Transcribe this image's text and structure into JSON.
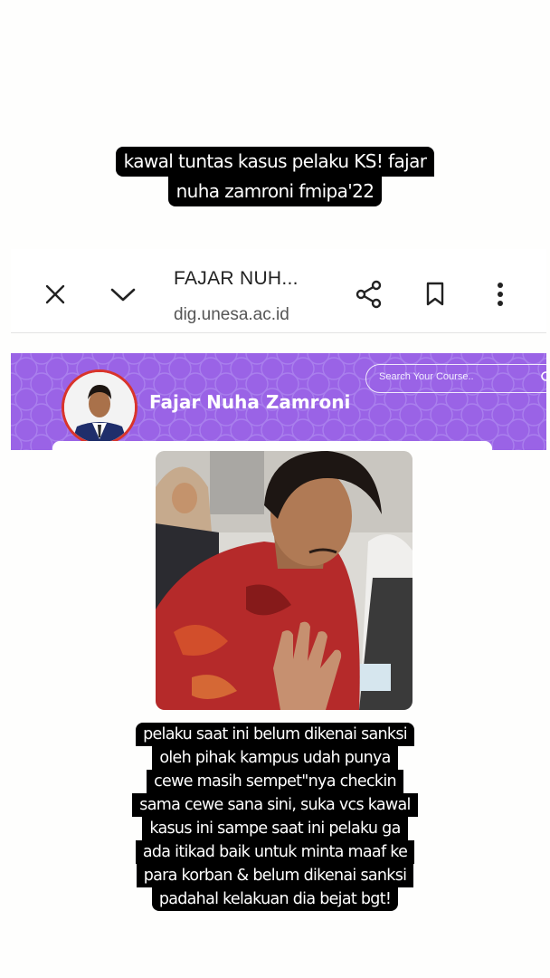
{
  "caption_top": {
    "lines": [
      "kawal tuntas kasus pelaku KS! fajar",
      "nuha zamroni fmipa'22"
    ]
  },
  "browser": {
    "page_title": "FAJAR NUH...",
    "url": "dig.unesa.ac.id",
    "icons": [
      "close-icon",
      "chevron-down-icon",
      "share-icon",
      "bookmark-icon",
      "more-vert-icon"
    ]
  },
  "profile": {
    "name": "Fajar Nuha Zamroni",
    "search_placeholder": "Search Your Course..",
    "banner_color": "#9a63e6",
    "avatar_border_color": "#d9342b"
  },
  "caption_bottom": {
    "lines": [
      "pelaku saat ini belum dikenai sanksi",
      "oleh pihak kampus udah punya",
      "cewe masih sempet\"nya checkin",
      "sama cewe sana sini, suka vcs kawal",
      "kasus ini sampe saat ini pelaku ga",
      "ada itikad baik untuk minta maaf ke",
      "para korban & belum dikenai sanksi",
      "padahal kelakuan dia bejat bgt!"
    ]
  }
}
